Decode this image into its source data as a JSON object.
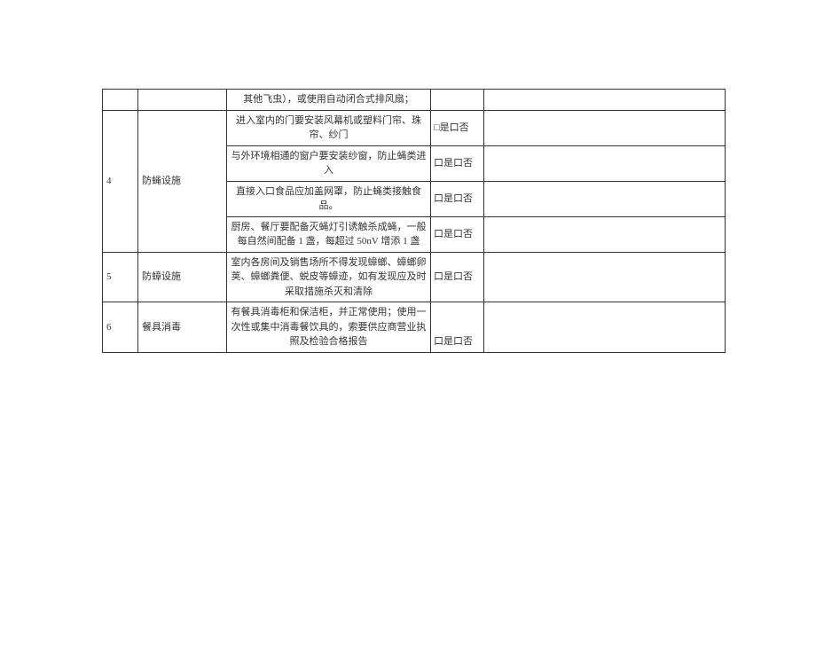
{
  "check_yes_no": "口是口否",
  "check_yes_no_alt": "□是口否",
  "rows": {
    "header_row": {
      "desc": "其他飞虫），或使用自动闭合式排风扇；"
    },
    "row4": {
      "num": "4",
      "category": "防蝇设施",
      "items": [
        "进入室内的门要安装风幕机或塑料门帘、珠帘、纱门",
        "与外环境相通的窗户要安装纱窗，防止蝇类进入",
        "直接入口食品应加盖网罩，防止蝇类接触食品。",
        "厨房、餐厅要配备灭蝇灯引诱触杀成蝇，一般每自然间配备 1 盏，每超过 50nV 增添 1 盏"
      ]
    },
    "row5": {
      "num": "5",
      "category": "防蟑设施",
      "desc": "室内各房间及销售场所不得发现蟑螂、蟑螂卵荚、蟑螂粪便、蜕皮等蟑迹，如有发现应及时采取措施杀灭和清除"
    },
    "row6": {
      "num": "6",
      "category": "餐具消毒",
      "desc": "有餐具消毒柜和保洁柜，并正常使用；使用一次性或集中消毒餐饮具的，索要供应商营业执照及检验合格报告"
    }
  }
}
